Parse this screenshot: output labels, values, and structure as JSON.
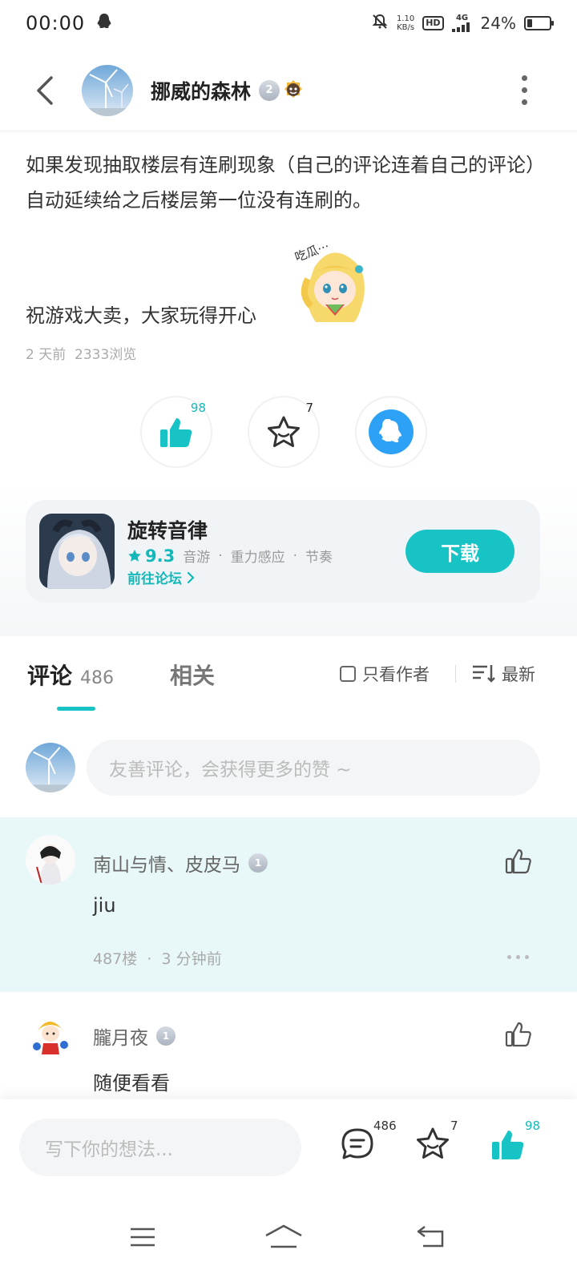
{
  "status_bar": {
    "time": "00:00",
    "net_speed_value": "1.10",
    "net_speed_unit": "KB/s",
    "hd": "HD",
    "network": "4G",
    "battery_percent": "24%",
    "battery_level": 0.24
  },
  "header": {
    "author_name": "挪威的森林",
    "level_badge": "2"
  },
  "post": {
    "text": "如果发现抽取楼层有连刷现象（自己的评论连着自己的评论）自动延续给之后楼层第一位没有连刷的。",
    "wish": "祝游戏大卖，大家玩得开心",
    "sticker_text": "吃瓜···",
    "time_ago": "2 天前",
    "views": "2333浏览"
  },
  "actions": {
    "like_count": "98",
    "favorite_count": "7"
  },
  "game_card": {
    "title": "旋转音律",
    "rating": "9.3",
    "tags": [
      "音游",
      "重力感应",
      "节奏"
    ],
    "forum_link": "前往论坛",
    "download_label": "下载"
  },
  "tabs": {
    "comment_label": "评论",
    "comment_count": "486",
    "related_label": "相关",
    "only_author_label": "只看作者",
    "sort_label": "最新"
  },
  "comment_input": {
    "placeholder": "友善评论，会获得更多的赞 ~"
  },
  "comments": [
    {
      "user": "南山与情、皮皮马",
      "level": "1",
      "text": "jiu",
      "floor": "487楼",
      "time": "3 分钟前"
    },
    {
      "user": "朧月夜",
      "level": "1",
      "text": "随便看看"
    }
  ],
  "bottom_bar": {
    "placeholder": "写下你的想法...",
    "comment_count": "486",
    "favorite_count": "7",
    "like_count": "98"
  },
  "colors": {
    "accent": "#17c3c4",
    "accent_text": "#14b8b9",
    "highlight_bg": "#e8f7f8",
    "qq_blue": "#2da1f5"
  }
}
